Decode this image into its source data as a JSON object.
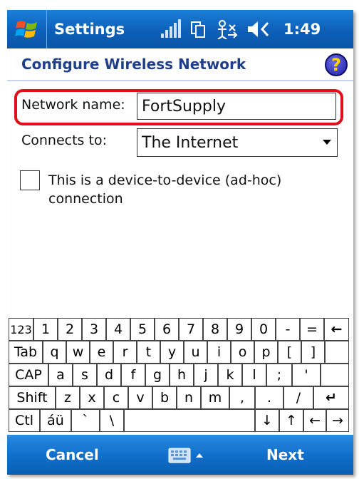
{
  "titlebar": {
    "title": "Settings",
    "time": "1:49"
  },
  "header": {
    "title": "Configure Wireless Network",
    "help_glyph": "?"
  },
  "form": {
    "network_name_label": "Network name:",
    "network_name_value": "FortSupply",
    "connects_to_label": "Connects to:",
    "connects_to_value": "The Internet",
    "adhoc_label_line1": "This is a device-to-device (ad-hoc)",
    "adhoc_label_line2": "connection",
    "adhoc_checked": false
  },
  "keyboard": {
    "row1": [
      "123",
      "1",
      "2",
      "3",
      "4",
      "5",
      "6",
      "7",
      "8",
      "9",
      "0",
      "-",
      "=",
      "←"
    ],
    "row2": [
      "Tab",
      "q",
      "w",
      "e",
      "r",
      "t",
      "y",
      "u",
      "i",
      "o",
      "p",
      "[",
      "]"
    ],
    "row3": [
      "CAP",
      "a",
      "s",
      "d",
      "f",
      "g",
      "h",
      "j",
      "k",
      "l",
      ";",
      "'"
    ],
    "row4": [
      "Shift",
      "z",
      "x",
      "c",
      "v",
      "b",
      "n",
      "m",
      ",",
      ".",
      "/",
      "↵"
    ],
    "row5": [
      "Ctl",
      "áü",
      "`",
      "\\",
      "",
      "↓",
      "↑",
      "←",
      "→"
    ]
  },
  "menubar": {
    "left": "Cancel",
    "right": "Next"
  },
  "colors": {
    "accent_blue": "#0d5fb8",
    "header_text": "#1e3f8a",
    "highlight_red": "#e0101a"
  }
}
